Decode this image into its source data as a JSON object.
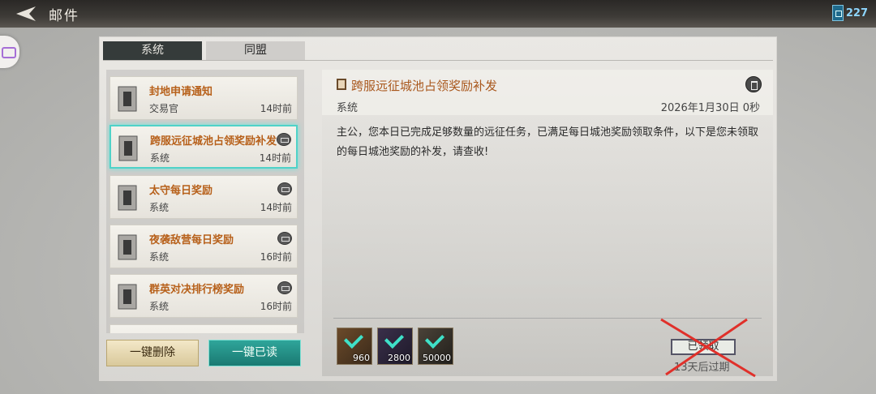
{
  "header": {
    "title": "邮件",
    "counter": "227"
  },
  "tabs": [
    {
      "label": "系统"
    },
    {
      "label": "同盟"
    }
  ],
  "mails": [
    {
      "title": "封地申请通知",
      "sender": "交易官",
      "time": "14时前"
    },
    {
      "title": "跨服远征城池占领奖励补发",
      "sender": "系统",
      "time": "14时前"
    },
    {
      "title": "太守每日奖励",
      "sender": "系统",
      "time": "14时前"
    },
    {
      "title": "夜袭敌营每日奖励",
      "sender": "系统",
      "time": "16时前"
    },
    {
      "title": "群英对决排行榜奖励",
      "sender": "系统",
      "time": "16时前"
    }
  ],
  "list_buttons": {
    "delete_all": "一键删除",
    "read_all": "一键已读"
  },
  "detail": {
    "title": "跨服远征城池占领奖励补发",
    "sender": "系统",
    "date": "2026年1月30日 0秒",
    "body": "主公，您本日已完成足够数量的远征任务，已满足每日城池奖励领取条件，以下是您未领取的每日城池奖励的补发，请查收!",
    "rewards": [
      {
        "qty": "960"
      },
      {
        "qty": "2800"
      },
      {
        "qty": "50000"
      }
    ],
    "claimed_label": "已领取",
    "expire": "13天后过期"
  },
  "colors": {
    "accent_teal": "#4fd2c8",
    "title_orange": "#b7601a",
    "cross_red": "#e0302a"
  }
}
